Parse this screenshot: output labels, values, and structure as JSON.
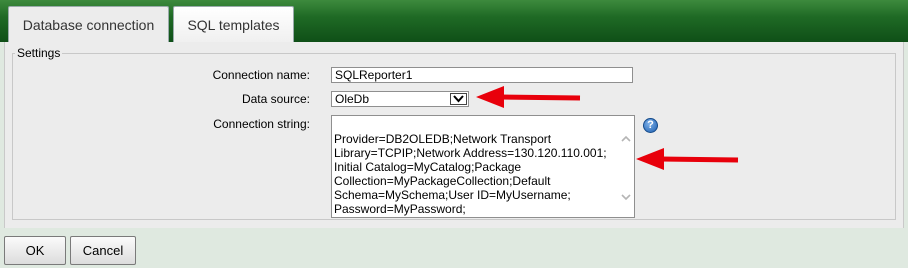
{
  "tabs": [
    {
      "label": "Database connection",
      "active": true
    },
    {
      "label": "SQL templates",
      "active": false
    }
  ],
  "settings": {
    "legend": "Settings",
    "connection_name": {
      "label": "Connection name:",
      "value": "SQLReporter1"
    },
    "data_source": {
      "label": "Data source:",
      "value": "OleDb"
    },
    "connection_string": {
      "label": "Connection string:",
      "value": "Provider=DB2OLEDB;Network Transport\nLibrary=TCPIP;Network Address=130.120.110.001;\nInitial Catalog=MyCatalog;Package\nCollection=MyPackageCollection;Default\nSchema=MySchema;User ID=MyUsername;\nPassword=MyPassword;"
    },
    "help_icon": "help-icon"
  },
  "buttons": {
    "ok": "OK",
    "cancel": "Cancel"
  },
  "colors": {
    "header_green": "#1f6a25",
    "arrow_red": "#e8000b",
    "page_bg": "#dfe9e0"
  }
}
